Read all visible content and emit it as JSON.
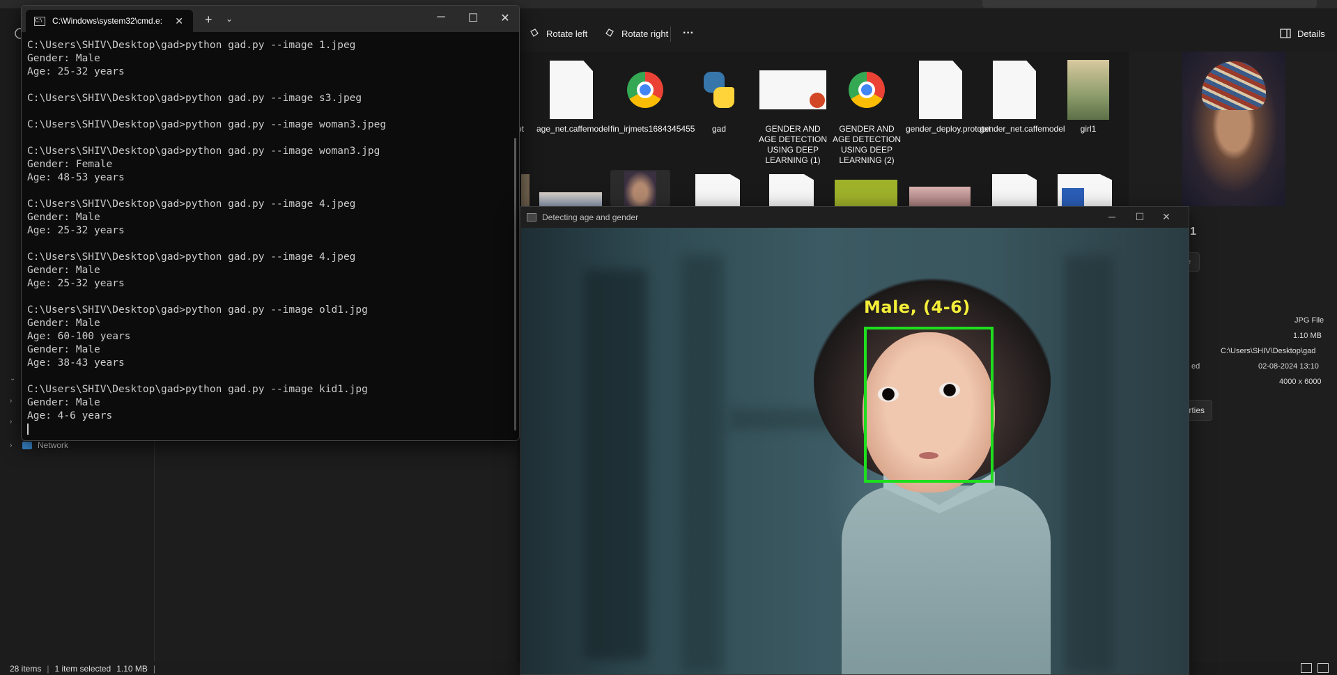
{
  "explorer": {
    "toolbar": {
      "rotate_left": "Rotate left",
      "rotate_right": "Rotate right",
      "more": "···",
      "details": "Details"
    },
    "sidebar": {
      "network": "Network"
    },
    "files_row1": [
      {
        "name": "ot",
        "icon": "document-icon"
      },
      {
        "name": "age_net.caffemodel",
        "icon": "document-icon"
      },
      {
        "name": "fin_irjmets1684345455",
        "icon": "chrome-icon"
      },
      {
        "name": "gad",
        "icon": "python-icon"
      },
      {
        "name": "GENDER AND AGE DETECTION USING DEEP LEARNING (1)",
        "icon": "powerpoint-icon"
      },
      {
        "name": "GENDER AND AGE DETECTION USING DEEP LEARNING (2)",
        "icon": "chrome-icon"
      },
      {
        "name": "gender_deploy.prototxt",
        "icon": "document-icon"
      },
      {
        "name": "gender_net.caffemodel",
        "icon": "document-icon"
      },
      {
        "name": "girl1",
        "icon": "image-thumbnail"
      }
    ],
    "preview": {
      "type_value": "JPG File",
      "size_value": "1.10 MB",
      "path_value": "C:\\Users\\SHIV\\Desktop\\gad",
      "date_label": "ed",
      "date_value": "02-08-2024 13:10",
      "dims_value": "4000 x 6000",
      "properties_btn": "erties",
      "title_fragment": "1",
      "btn_fragment": "e"
    },
    "status": {
      "items": "28 items",
      "selected": "1 item selected",
      "size": "1.10 MB"
    }
  },
  "cmd": {
    "tab_title": "C:\\Windows\\system32\\cmd.e:",
    "lines": [
      "C:\\Users\\SHIV\\Desktop\\gad>python gad.py --image 1.jpeg",
      "Gender: Male",
      "Age: 25-32 years",
      "",
      "C:\\Users\\SHIV\\Desktop\\gad>python gad.py --image s3.jpeg",
      "",
      "C:\\Users\\SHIV\\Desktop\\gad>python gad.py --image woman3.jpeg",
      "",
      "C:\\Users\\SHIV\\Desktop\\gad>python gad.py --image woman3.jpg",
      "Gender: Female",
      "Age: 48-53 years",
      "",
      "C:\\Users\\SHIV\\Desktop\\gad>python gad.py --image 4.jpeg",
      "Gender: Male",
      "Age: 25-32 years",
      "",
      "C:\\Users\\SHIV\\Desktop\\gad>python gad.py --image 4.jpeg",
      "Gender: Male",
      "Age: 25-32 years",
      "",
      "C:\\Users\\SHIV\\Desktop\\gad>python gad.py --image old1.jpg",
      "Gender: Male",
      "Age: 60-100 years",
      "Gender: Male",
      "Age: 38-43 years",
      "",
      "C:\\Users\\SHIV\\Desktop\\gad>python gad.py --image kid1.jpg",
      "Gender: Male",
      "Age: 4-6 years"
    ]
  },
  "detect_window": {
    "title": "Detecting age and gender",
    "label": "Male, (4-6)",
    "box_color": "#1ede1e",
    "label_color": "#f4ee3a"
  }
}
